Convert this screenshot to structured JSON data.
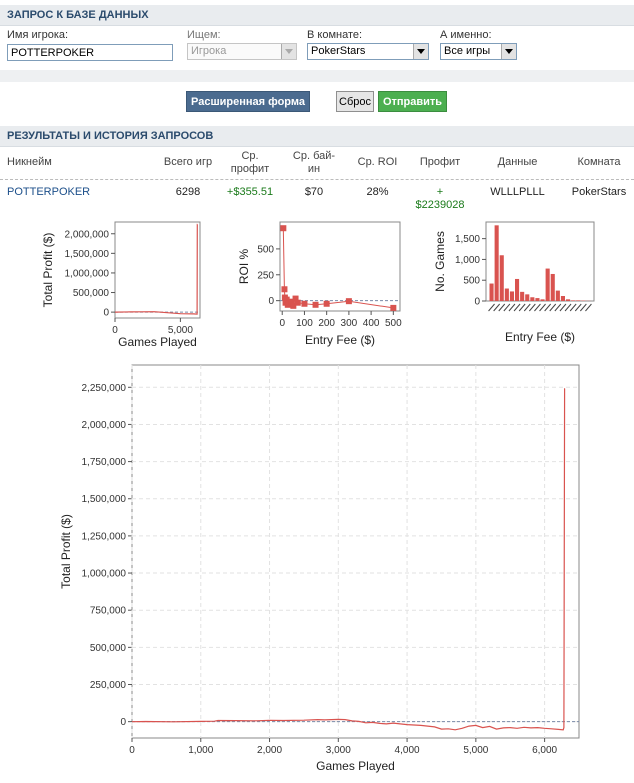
{
  "query": {
    "title": "ЗАПРОС К БАЗЕ ДАННЫХ",
    "player_label": "Имя игрока:",
    "player_value": "POTTERPOKER",
    "search_label": "Ищем:",
    "search_value": "Игрока",
    "room_label": "В комнате:",
    "room_value": "PokerStars",
    "what_label": "А именно:",
    "what_value": "Все игры"
  },
  "buttons": {
    "advanced": "Расширенная форма",
    "reset": "Сброс",
    "submit": "Отправить"
  },
  "results": {
    "title": "РЕЗУЛЬТАТЫ И ИСТОРИЯ ЗАПРОСОВ",
    "headers": {
      "nick": "Никнейм",
      "games": "Всего игр",
      "avg_profit": "Ср. профит",
      "avg_buyin": "Ср. бай-ин",
      "roi": "Ср. ROI",
      "profit": "Профит",
      "data": "Данные",
      "room": "Комната"
    },
    "row": {
      "nick": "POTTERPOKER",
      "games": "6298",
      "avg_profit": "+$355.51",
      "avg_buyin": "$70",
      "roi": "28%",
      "profit_sign": "+",
      "profit": "$2239028",
      "data": "WLLLPLLL",
      "room": "PokerStars"
    }
  },
  "colors": {
    "series": "#d9534f",
    "header_text": "#2b4b6d",
    "positive": "#1a7a1a"
  },
  "chart_data": [
    {
      "type": "line",
      "xlabel": "Games Played",
      "ylabel": "Total Profit ($)",
      "xticks": [
        "0",
        "5,000"
      ],
      "yticks": [
        "0",
        "500,000",
        "1,000,000",
        "1,500,000",
        "2,000,000"
      ],
      "xlim": [
        0,
        6500
      ],
      "ylim": [
        -150000,
        2300000
      ],
      "x": [
        0,
        1200,
        2000,
        3000,
        4000,
        5000,
        6000,
        6280,
        6290,
        6298
      ],
      "y": [
        0,
        5000,
        8000,
        10000,
        -15000,
        -40000,
        -45000,
        -50000,
        2239028,
        2239028
      ]
    },
    {
      "type": "scatter",
      "xlabel": "Entry Fee ($)",
      "ylabel": "ROI %",
      "xticks": [
        "0",
        "100",
        "200",
        "300",
        "400",
        "500"
      ],
      "yticks": [
        "0",
        "250",
        "500"
      ],
      "xlim": [
        -10,
        530
      ],
      "ylim": [
        -100,
        760
      ],
      "x": [
        5,
        10,
        12,
        15,
        20,
        25,
        30,
        40,
        50,
        60,
        70,
        100,
        150,
        200,
        300,
        500
      ],
      "y": [
        700,
        110,
        30,
        -20,
        10,
        -40,
        -30,
        -10,
        -50,
        20,
        -20,
        -30,
        -40,
        -30,
        -5,
        -70
      ]
    },
    {
      "type": "bar",
      "xlabel": "Entry Fee ($)",
      "ylabel": "No. Games",
      "yticks": [
        "0",
        "500",
        "1,000",
        "1,500"
      ],
      "ylim": [
        0,
        1900
      ],
      "values": [
        420,
        1820,
        1100,
        300,
        230,
        530,
        220,
        160,
        90,
        70,
        40,
        780,
        650,
        250,
        120,
        40,
        15,
        15,
        10,
        5
      ]
    },
    {
      "type": "line",
      "xlabel": "Games Played",
      "ylabel": "Total Profit ($)",
      "xticks": [
        "0",
        "1,000",
        "2,000",
        "3,000",
        "4,000",
        "5,000",
        "6,000"
      ],
      "yticks": [
        "0",
        "250,000",
        "500,000",
        "750,000",
        "1,000,000",
        "1,250,000",
        "1,500,000",
        "1,750,000",
        "2,000,000",
        "2,250,000"
      ],
      "xlim": [
        0,
        6500
      ],
      "ylim": [
        -110000,
        2400000
      ],
      "x": [
        0,
        200,
        600,
        1000,
        1200,
        1250,
        1500,
        1800,
        2000,
        2200,
        2500,
        2700,
        2800,
        3000,
        3100,
        3200,
        3300,
        3400,
        3500,
        3600,
        3700,
        3800,
        4000,
        4200,
        4400,
        4500,
        4600,
        4700,
        4800,
        4900,
        5000,
        5100,
        5200,
        5300,
        5400,
        5500,
        5600,
        5700,
        5800,
        5900,
        6000,
        6100,
        6200,
        6270,
        6280,
        6290,
        6298
      ],
      "y": [
        0,
        1000,
        -1000,
        2000,
        3000,
        8000,
        7000,
        6000,
        9000,
        8000,
        10000,
        14000,
        12000,
        15000,
        14000,
        5000,
        2000,
        -8000,
        -5000,
        -12000,
        -15000,
        -10000,
        -20000,
        -25000,
        -35000,
        -50000,
        -48000,
        -55000,
        -45000,
        -30000,
        -25000,
        -40000,
        -32000,
        -50000,
        -42000,
        -40000,
        -45000,
        -38000,
        -42000,
        -40000,
        -45000,
        -48000,
        -52000,
        -55000,
        -40000,
        2239028,
        2239028
      ]
    }
  ]
}
